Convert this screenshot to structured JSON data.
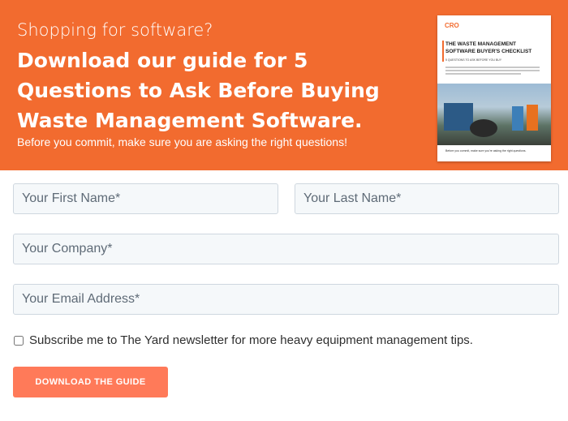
{
  "banner": {
    "eyebrow": "Shopping for software?",
    "headline": "Download our guide for 5 Questions to Ask Before Buying Waste Management Software.",
    "subtext": "Before you commit, make sure you are asking the right questions!",
    "background_color": "#f26b2f"
  },
  "guide_cover": {
    "logo_text": "CRO",
    "title": "THE WASTE MANAGEMENT SOFTWARE BUYER'S CHECKLIST",
    "kicker": "5 QUESTIONS TO ASK BEFORE YOU BUY",
    "footer": "Before you commit, make sure you're asking the right questions."
  },
  "form": {
    "first_name_placeholder": "Your First Name*",
    "last_name_placeholder": "Your Last Name*",
    "company_placeholder": "Your Company*",
    "email_placeholder": "Your Email Address*",
    "subscribe_label": "Subscribe me to The Yard newsletter for more heavy equipment management tips.",
    "subscribe_checked": false,
    "submit_label": "DOWNLOAD THE GUIDE",
    "submit_color": "#ff7a59"
  }
}
